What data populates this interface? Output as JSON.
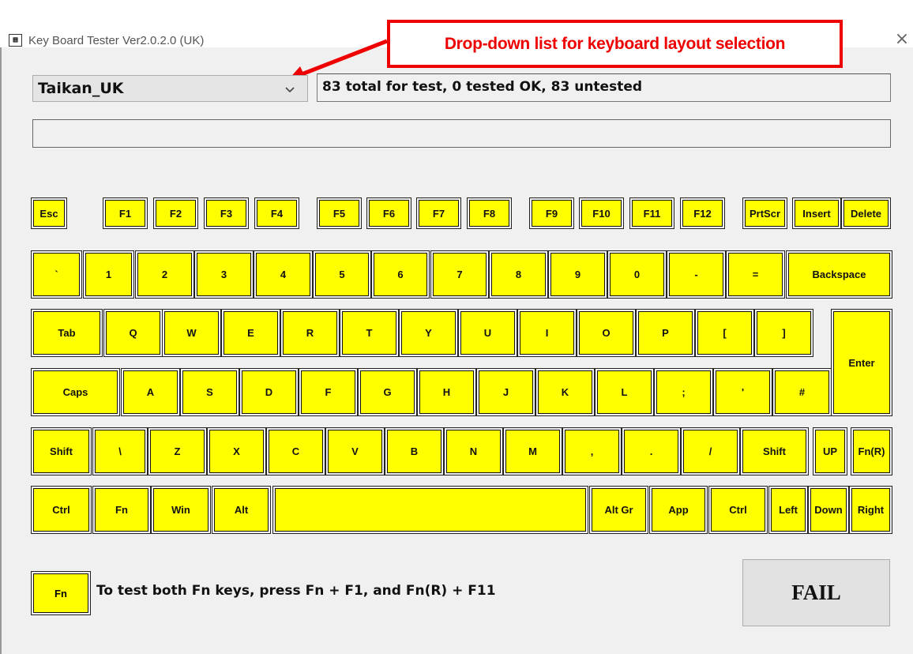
{
  "window": {
    "title": "Key Board Tester Ver2.0.2.0 (UK)",
    "icon": "keyboard-grid-icon",
    "close_glyph": "×"
  },
  "annotation": {
    "text": "Drop-down list for keyboard layout selection",
    "color": "#ee0000"
  },
  "layout_select": {
    "value": "Taikan_UK",
    "icon": "chevron-down-icon"
  },
  "status": {
    "text": "83 total for test, 0 tested OK, 83 untested"
  },
  "input": {
    "value": ""
  },
  "key_color": "#ffff00",
  "rows": [
    {
      "name": "function-row",
      "keys": [
        "Esc",
        "F1",
        "F2",
        "F3",
        "F4",
        "F5",
        "F6",
        "F7",
        "F8",
        "F9",
        "F10",
        "F11",
        "F12",
        "PrtScr",
        "Insert",
        "Delete"
      ]
    },
    {
      "name": "number-row",
      "keys": [
        "`",
        "1",
        "2",
        "3",
        "4",
        "5",
        "6",
        "7",
        "8",
        "9",
        "0",
        "-",
        "=",
        "Backspace"
      ]
    },
    {
      "name": "qwerty-row",
      "keys": [
        "Tab",
        "Q",
        "W",
        "E",
        "R",
        "T",
        "Y",
        "U",
        "I",
        "O",
        "P",
        "[",
        "]",
        "Enter"
      ]
    },
    {
      "name": "home-row",
      "keys": [
        "Caps",
        "A",
        "S",
        "D",
        "F",
        "G",
        "H",
        "J",
        "K",
        "L",
        ";",
        "'",
        "#"
      ]
    },
    {
      "name": "shift-row",
      "keys": [
        "Shift",
        "\\",
        "Z",
        "X",
        "C",
        "V",
        "B",
        "N",
        "M",
        ",",
        ".",
        "/",
        "Shift",
        "UP",
        "Fn(R)"
      ]
    },
    {
      "name": "bottom-row",
      "keys": [
        "Ctrl",
        "Fn",
        "Win",
        "Alt",
        "",
        "Alt Gr",
        "App",
        "Ctrl",
        "Left",
        "Down",
        "Right"
      ]
    }
  ],
  "legend": {
    "key_label": "Fn",
    "hint": "To test both Fn keys, press Fn + F1, and Fn(R) + F11"
  },
  "result": {
    "label": "FAIL"
  }
}
